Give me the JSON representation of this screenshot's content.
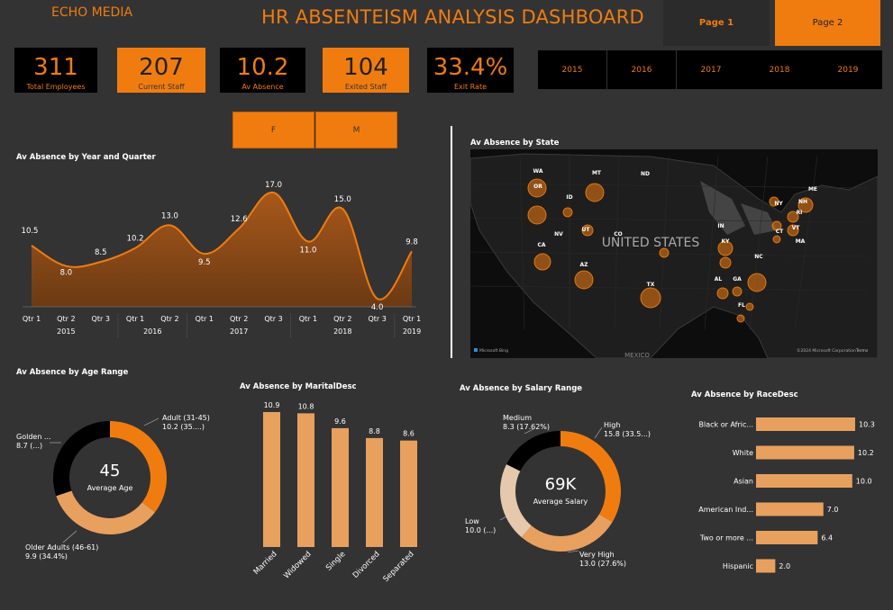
{
  "header": {
    "brand": "ECHO MEDIA",
    "title": "HR ABSENTEISM ANALYSIS DASHBOARD",
    "page1": "Page 1",
    "page2": "Page 2"
  },
  "kpis": [
    {
      "value": "311",
      "label": "Total Employees"
    },
    {
      "value": "207",
      "label": "Current Staff"
    },
    {
      "value": "10.2",
      "label": "Av Absence"
    },
    {
      "value": "104",
      "label": "Exited Staff"
    },
    {
      "value": "33.4%",
      "label": "Exit Rate"
    }
  ],
  "years": [
    "2015",
    "2016",
    "2017",
    "2018",
    "2019"
  ],
  "gender": [
    "F",
    "M"
  ],
  "colors": {
    "accent": "#f07c10",
    "light": "#e8a05f",
    "pale": "#e6c9ad",
    "black": "#000000"
  },
  "map": {
    "title": "Av Absence by State",
    "country_label": "UNITED STATES",
    "mexico_label": "MEXICO",
    "bing": "Microsoft Bing",
    "copyright": "©2024 Microsoft Corporation",
    "terms": "Terms",
    "states": [
      "WA",
      "MT",
      "ND",
      "OR",
      "ID",
      "ME",
      "NH",
      "NY",
      "RI",
      "CT",
      "VT",
      "MA",
      "IN",
      "KY",
      "CA",
      "NV",
      "UT",
      "CO",
      "AZ",
      "NC",
      "TX",
      "AL",
      "GA",
      "FL"
    ]
  },
  "chart_data": [
    {
      "type": "area",
      "title": "Av Absence by Year and Quarter",
      "categories": [
        "Qtr 1",
        "Qtr 2",
        "Qtr 3",
        "Qtr 1",
        "Qtr 2",
        "Qtr 1",
        "Qtr 2",
        "Qtr 3",
        "Qtr 1",
        "Qtr 2",
        "Qtr 3",
        "Qtr 1"
      ],
      "years": [
        {
          "label": "2015",
          "start": 0,
          "end": 2
        },
        {
          "label": "2016",
          "start": 3,
          "end": 4
        },
        {
          "label": "2017",
          "start": 5,
          "end": 7
        },
        {
          "label": "2018",
          "start": 8,
          "end": 10
        },
        {
          "label": "2019",
          "start": 11,
          "end": 11
        }
      ],
      "values": [
        10.5,
        8.0,
        8.5,
        10.2,
        13.0,
        9.5,
        12.6,
        17.0,
        11.0,
        15.0,
        4.0,
        9.8
      ],
      "labels": [
        "10.5",
        "8.0",
        "8.5",
        "10.2",
        "13.0",
        "9.5",
        "12.6",
        "17.0",
        "11.0",
        "15.0",
        "4.0",
        "9.8"
      ],
      "ylim": [
        3,
        18
      ]
    },
    {
      "type": "pie",
      "title": "Av Absence by Age Range",
      "center_value": "45",
      "center_label": "Average Age",
      "slices": [
        {
          "name": "Adult (31-45)",
          "value": 10.2,
          "label": "10.2 (35....)",
          "color": "#f07c10"
        },
        {
          "name": "Older Adults (46-61)",
          "value": 9.9,
          "label": "9.9 (34.4%)",
          "color": "#e8a05f"
        },
        {
          "name": "Golden ...",
          "value": 8.7,
          "label": "8.7 (...)",
          "color": "#000000"
        }
      ]
    },
    {
      "type": "bar",
      "title": "Av Absence by MaritalDesc",
      "categories": [
        "Married",
        "Widowed",
        "Single",
        "Divorced",
        "Separated"
      ],
      "values": [
        10.9,
        10.8,
        9.6,
        8.8,
        8.6
      ],
      "labels": [
        "10.9",
        "10.8",
        "9.6",
        "8.8",
        "8.6"
      ],
      "ylim": [
        0,
        10.9
      ]
    },
    {
      "type": "pie",
      "title": "Av Absence by Salary Range",
      "center_value": "69K",
      "center_label": "Average Salary",
      "slices": [
        {
          "name": "High",
          "value": 15.8,
          "label": "15.8 (33.5...)",
          "color": "#f07c10"
        },
        {
          "name": "Very High",
          "value": 13.0,
          "label": "13.0 (27.6%)",
          "color": "#e8a05f"
        },
        {
          "name": "Low",
          "value": 10.0,
          "label": "10.0 (...)",
          "color": "#e6c9ad"
        },
        {
          "name": "Medium",
          "value": 8.3,
          "label": "8.3 (17.62%)",
          "color": "#000000"
        }
      ]
    },
    {
      "type": "bar",
      "title": "Av Absence by RaceDesc",
      "categories": [
        "Black or Afric...",
        "White",
        "Asian",
        "American Ind...",
        "Two or more ...",
        "Hispanic"
      ],
      "values": [
        10.3,
        10.2,
        10.0,
        7.0,
        6.4,
        2.0
      ],
      "labels": [
        "10.3",
        "10.2",
        "10.0",
        "7.0",
        "6.4",
        "2.0"
      ],
      "xlim": [
        0,
        10.3
      ]
    }
  ]
}
